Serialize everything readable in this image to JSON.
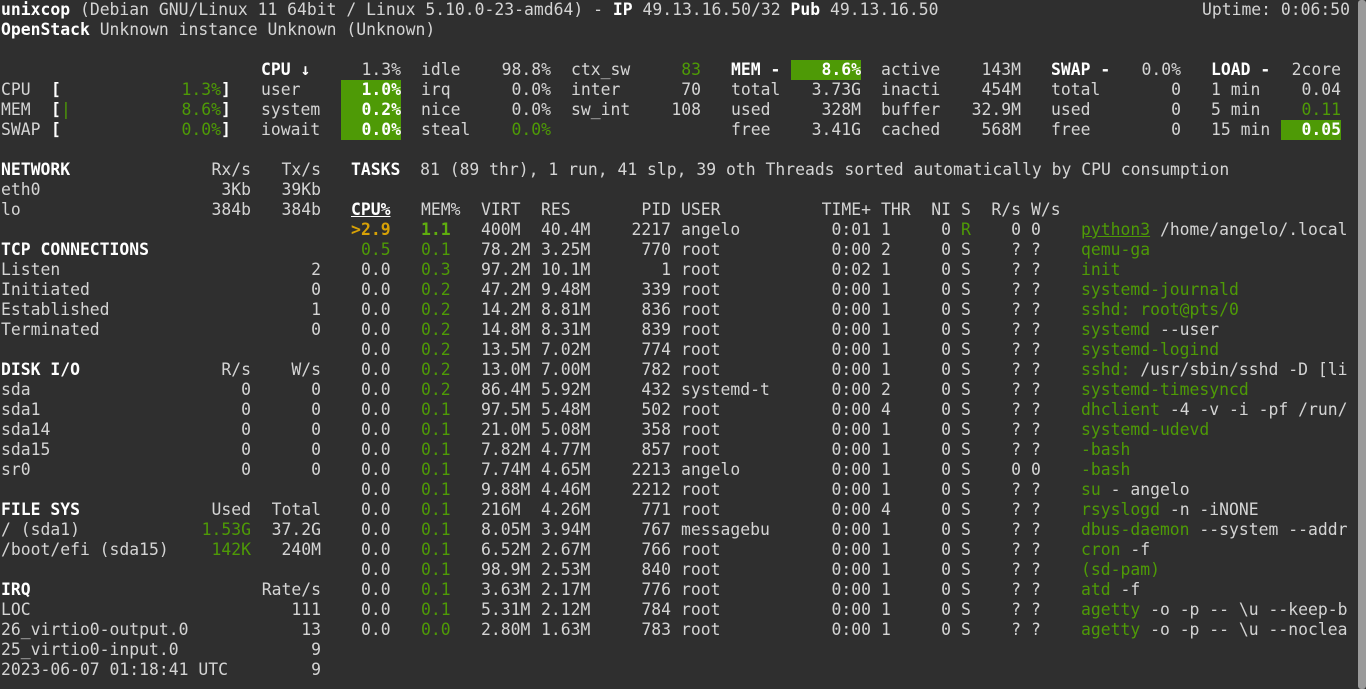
{
  "header": {
    "hostname": "unixcop",
    "os_info": "(Debian GNU/Linux 11 64bit / Linux 5.10.0-23-amd64) -",
    "ip_label": "IP",
    "ip_value": "49.13.16.50/32",
    "pub_label": "Pub",
    "pub_value": "49.13.16.50",
    "uptime": "Uptime: 0:06:50",
    "cloud_label": "OpenStack",
    "cloud_value": "Unknown instance Unknown (Unknown)"
  },
  "quicklook": {
    "rows": [
      {
        "label": "CPU",
        "bar": "",
        "percent": "1.3%",
        "fill": 0.013
      },
      {
        "label": "MEM",
        "bar": "|",
        "percent": "8.6%",
        "fill": 0.086
      },
      {
        "label": "SWAP",
        "bar": "",
        "percent": "0.0%",
        "fill": 0.0
      }
    ]
  },
  "cpu": {
    "title": "CPU",
    "sort_arrow": "↓",
    "total": "1.3%",
    "stats": [
      {
        "label": "user",
        "value": "1.0%"
      },
      {
        "label": "system",
        "value": "0.2%"
      },
      {
        "label": "iowait",
        "value": "0.0%"
      }
    ],
    "stats2": [
      {
        "label": "idle",
        "value": "98.8%"
      },
      {
        "label": "irq",
        "value": "0.0%"
      },
      {
        "label": "nice",
        "value": "0.0%"
      },
      {
        "label": "steal",
        "value": "0.0%"
      }
    ],
    "stats3": [
      {
        "label": "ctx_sw",
        "value": "83"
      },
      {
        "label": "inter",
        "value": "70"
      },
      {
        "label": "sw_int",
        "value": "108"
      }
    ]
  },
  "mem": {
    "title": "MEM -",
    "percent": "8.6%",
    "col1": [
      {
        "label": "total",
        "value": "3.73G"
      },
      {
        "label": "used",
        "value": "328M"
      },
      {
        "label": "free",
        "value": "3.41G"
      }
    ],
    "col2": [
      {
        "label": "active",
        "value": "143M"
      },
      {
        "label": "inacti",
        "value": "454M"
      },
      {
        "label": "buffer",
        "value": "32.9M"
      },
      {
        "label": "cached",
        "value": "568M"
      }
    ]
  },
  "swap": {
    "title": "SWAP -",
    "percent": "0.0%",
    "rows": [
      {
        "label": "total",
        "value": "0"
      },
      {
        "label": "used",
        "value": "0"
      },
      {
        "label": "free",
        "value": "0"
      }
    ]
  },
  "load": {
    "title": "LOAD -",
    "cores": "2core",
    "rows": [
      {
        "label": "1 min",
        "value": "0.04"
      },
      {
        "label": "5 min",
        "value": "0.11"
      },
      {
        "label": "15 min",
        "value": "0.05"
      }
    ]
  },
  "network": {
    "title": "NETWORK",
    "rx_header": "Rx/s",
    "tx_header": "Tx/s",
    "rows": [
      {
        "iface": "eth0",
        "rx": "3Kb",
        "tx": "39Kb"
      },
      {
        "iface": "lo",
        "rx": "384b",
        "tx": "384b"
      }
    ]
  },
  "tcp": {
    "title": "TCP CONNECTIONS",
    "rows": [
      {
        "label": "Listen",
        "value": "2"
      },
      {
        "label": "Initiated",
        "value": "0"
      },
      {
        "label": "Established",
        "value": "1"
      },
      {
        "label": "Terminated",
        "value": "0"
      }
    ]
  },
  "disk": {
    "title": "DISK I/O",
    "r_header": "R/s",
    "w_header": "W/s",
    "rows": [
      {
        "name": "sda",
        "r": "0",
        "w": "0"
      },
      {
        "name": "sda1",
        "r": "0",
        "w": "0"
      },
      {
        "name": "sda14",
        "r": "0",
        "w": "0"
      },
      {
        "name": "sda15",
        "r": "0",
        "w": "0"
      },
      {
        "name": "sr0",
        "r": "0",
        "w": "0"
      }
    ]
  },
  "fs": {
    "title": "FILE SYS",
    "used_header": "Used",
    "total_header": "Total",
    "rows": [
      {
        "mount": "/ (sda1)",
        "used": "1.53G",
        "total": "37.2G"
      },
      {
        "mount": "/boot/efi (sda15)",
        "used": "142K",
        "total": "240M"
      }
    ]
  },
  "irq": {
    "title": "IRQ",
    "rate_header": "Rate/s",
    "rows": [
      {
        "name": "LOC",
        "rate": "111"
      },
      {
        "name": "26_virtio0-output.0",
        "rate": "13"
      },
      {
        "name": "25_virtio0-input.0",
        "rate": "9"
      },
      {
        "name": "2023-06-07 01:18:41 UTC",
        "rate": "9"
      }
    ]
  },
  "tasks": {
    "title": "TASKS",
    "summary": "81 (89 thr), 1 run, 41 slp, 39 oth Threads sorted automatically by CPU consumption",
    "headers": {
      "cpu": "CPU%",
      "mem": "MEM%",
      "virt": "VIRT",
      "res": "RES",
      "pid": "PID",
      "user": "USER",
      "time": "TIME+",
      "thr": "THR",
      "ni": "NI",
      "s": "S",
      "rs": "R/s",
      "ws": "W/s"
    },
    "selected_marker": ">",
    "processes": [
      {
        "cpu": "2.9",
        "mem": "1.1",
        "virt": "400M",
        "res": "40.4M",
        "pid": "2217",
        "user": "angelo",
        "time": "0:01",
        "thr": "1",
        "ni": "0",
        "s": "R",
        "rs": "0",
        "ws": "0",
        "cmd": "python3",
        "args": " /home/angelo/.local"
      },
      {
        "cpu": "0.5",
        "mem": "0.1",
        "virt": "78.2M",
        "res": "3.25M",
        "pid": "770",
        "user": "root",
        "time": "0:00",
        "thr": "2",
        "ni": "0",
        "s": "S",
        "rs": "?",
        "ws": "?",
        "cmd": "qemu-ga",
        "args": ""
      },
      {
        "cpu": "0.0",
        "mem": "0.3",
        "virt": "97.2M",
        "res": "10.1M",
        "pid": "1",
        "user": "root",
        "time": "0:02",
        "thr": "1",
        "ni": "0",
        "s": "S",
        "rs": "?",
        "ws": "?",
        "cmd": "init",
        "args": ""
      },
      {
        "cpu": "0.0",
        "mem": "0.2",
        "virt": "47.2M",
        "res": "9.48M",
        "pid": "339",
        "user": "root",
        "time": "0:00",
        "thr": "1",
        "ni": "0",
        "s": "S",
        "rs": "?",
        "ws": "?",
        "cmd": "systemd-journald",
        "args": ""
      },
      {
        "cpu": "0.0",
        "mem": "0.2",
        "virt": "14.2M",
        "res": "8.81M",
        "pid": "836",
        "user": "root",
        "time": "0:00",
        "thr": "1",
        "ni": "0",
        "s": "S",
        "rs": "?",
        "ws": "?",
        "cmd": "sshd: root@pts/0",
        "args": ""
      },
      {
        "cpu": "0.0",
        "mem": "0.2",
        "virt": "14.8M",
        "res": "8.31M",
        "pid": "839",
        "user": "root",
        "time": "0:00",
        "thr": "1",
        "ni": "0",
        "s": "S",
        "rs": "?",
        "ws": "?",
        "cmd": "systemd",
        "args": " --user"
      },
      {
        "cpu": "0.0",
        "mem": "0.2",
        "virt": "13.5M",
        "res": "7.02M",
        "pid": "774",
        "user": "root",
        "time": "0:00",
        "thr": "1",
        "ni": "0",
        "s": "S",
        "rs": "?",
        "ws": "?",
        "cmd": "systemd-logind",
        "args": ""
      },
      {
        "cpu": "0.0",
        "mem": "0.2",
        "virt": "13.0M",
        "res": "7.00M",
        "pid": "782",
        "user": "root",
        "time": "0:00",
        "thr": "1",
        "ni": "0",
        "s": "S",
        "rs": "?",
        "ws": "?",
        "cmd": "sshd:",
        "args": " /usr/sbin/sshd -D [li"
      },
      {
        "cpu": "0.0",
        "mem": "0.2",
        "virt": "86.4M",
        "res": "5.92M",
        "pid": "432",
        "user": "systemd-t",
        "time": "0:00",
        "thr": "2",
        "ni": "0",
        "s": "S",
        "rs": "?",
        "ws": "?",
        "cmd": "systemd-timesyncd",
        "args": ""
      },
      {
        "cpu": "0.0",
        "mem": "0.1",
        "virt": "97.5M",
        "res": "5.48M",
        "pid": "502",
        "user": "root",
        "time": "0:00",
        "thr": "4",
        "ni": "0",
        "s": "S",
        "rs": "?",
        "ws": "?",
        "cmd": "dhclient",
        "args": " -4 -v -i -pf /run/"
      },
      {
        "cpu": "0.0",
        "mem": "0.1",
        "virt": "21.0M",
        "res": "5.08M",
        "pid": "358",
        "user": "root",
        "time": "0:00",
        "thr": "1",
        "ni": "0",
        "s": "S",
        "rs": "?",
        "ws": "?",
        "cmd": "systemd-udevd",
        "args": ""
      },
      {
        "cpu": "0.0",
        "mem": "0.1",
        "virt": "7.82M",
        "res": "4.77M",
        "pid": "857",
        "user": "root",
        "time": "0:00",
        "thr": "1",
        "ni": "0",
        "s": "S",
        "rs": "?",
        "ws": "?",
        "cmd": "-bash",
        "args": ""
      },
      {
        "cpu": "0.0",
        "mem": "0.1",
        "virt": "7.74M",
        "res": "4.65M",
        "pid": "2213",
        "user": "angelo",
        "time": "0:00",
        "thr": "1",
        "ni": "0",
        "s": "S",
        "rs": "0",
        "ws": "0",
        "cmd": "-bash",
        "args": ""
      },
      {
        "cpu": "0.0",
        "mem": "0.1",
        "virt": "9.88M",
        "res": "4.46M",
        "pid": "2212",
        "user": "root",
        "time": "0:00",
        "thr": "1",
        "ni": "0",
        "s": "S",
        "rs": "?",
        "ws": "?",
        "cmd": "su",
        "args": " - angelo"
      },
      {
        "cpu": "0.0",
        "mem": "0.1",
        "virt": "216M",
        "res": "4.26M",
        "pid": "771",
        "user": "root",
        "time": "0:00",
        "thr": "4",
        "ni": "0",
        "s": "S",
        "rs": "?",
        "ws": "?",
        "cmd": "rsyslogd",
        "args": " -n -iNONE"
      },
      {
        "cpu": "0.0",
        "mem": "0.1",
        "virt": "8.05M",
        "res": "3.94M",
        "pid": "767",
        "user": "messagebu",
        "time": "0:00",
        "thr": "1",
        "ni": "0",
        "s": "S",
        "rs": "?",
        "ws": "?",
        "cmd": "dbus-daemon",
        "args": " --system --addr"
      },
      {
        "cpu": "0.0",
        "mem": "0.1",
        "virt": "6.52M",
        "res": "2.67M",
        "pid": "766",
        "user": "root",
        "time": "0:00",
        "thr": "1",
        "ni": "0",
        "s": "S",
        "rs": "?",
        "ws": "?",
        "cmd": "cron",
        "args": " -f"
      },
      {
        "cpu": "0.0",
        "mem": "0.1",
        "virt": "98.9M",
        "res": "2.53M",
        "pid": "840",
        "user": "root",
        "time": "0:00",
        "thr": "1",
        "ni": "0",
        "s": "S",
        "rs": "?",
        "ws": "?",
        "cmd": "(sd-pam)",
        "args": ""
      },
      {
        "cpu": "0.0",
        "mem": "0.1",
        "virt": "3.63M",
        "res": "2.17M",
        "pid": "776",
        "user": "root",
        "time": "0:00",
        "thr": "1",
        "ni": "0",
        "s": "S",
        "rs": "?",
        "ws": "?",
        "cmd": "atd",
        "args": " -f"
      },
      {
        "cpu": "0.0",
        "mem": "0.1",
        "virt": "5.31M",
        "res": "2.12M",
        "pid": "784",
        "user": "root",
        "time": "0:00",
        "thr": "1",
        "ni": "0",
        "s": "S",
        "rs": "?",
        "ws": "?",
        "cmd": "agetty",
        "args": " -o -p -- \\u --keep-b"
      },
      {
        "cpu": "0.0",
        "mem": "0.0",
        "virt": "2.80M",
        "res": "1.63M",
        "pid": "783",
        "user": "root",
        "time": "0:00",
        "thr": "1",
        "ni": "0",
        "s": "S",
        "rs": "?",
        "ws": "?",
        "cmd": "agetty",
        "args": " -o -p -- \\u --noclea"
      }
    ]
  },
  "colors": {
    "background": "#2f2f2f",
    "text": "#d4d4d4",
    "accent_green": "#4e9a06",
    "selected_marker": "#d7a106"
  }
}
